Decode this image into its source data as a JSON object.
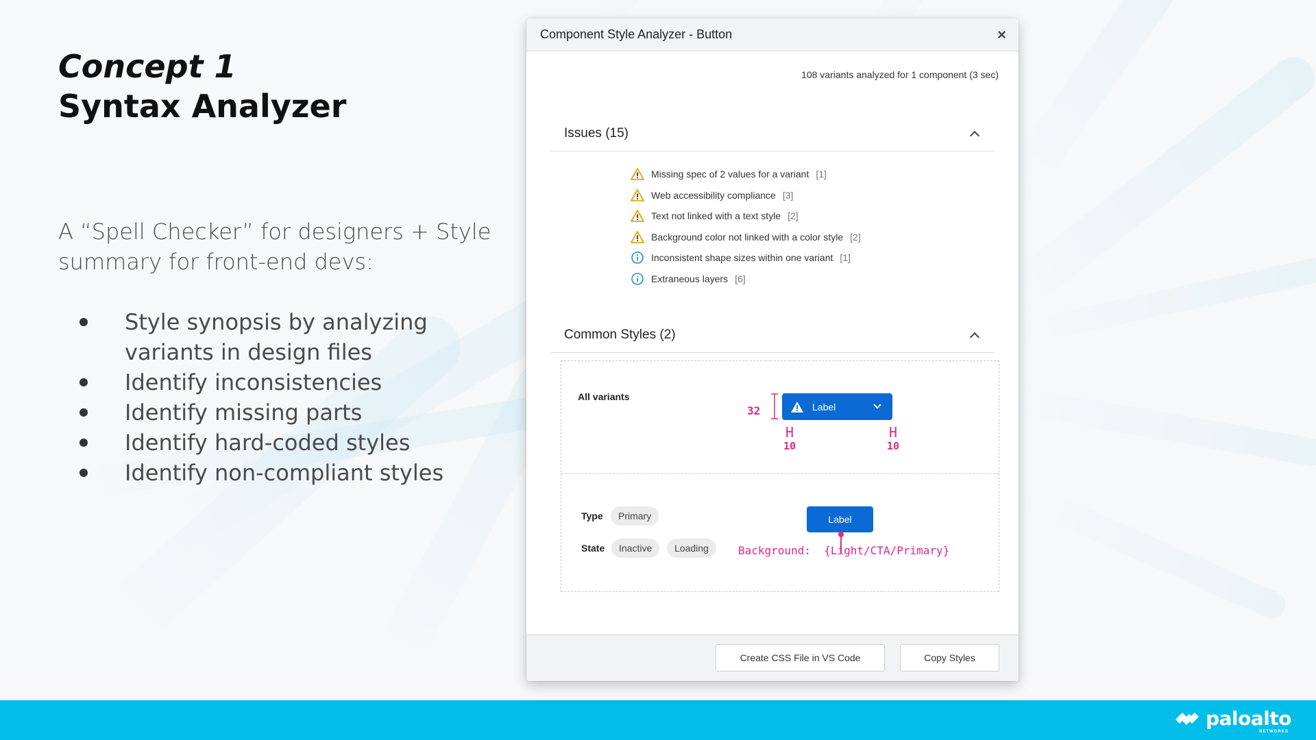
{
  "slide": {
    "title_line1": "Concept 1",
    "title_line2": "Syntax Analyzer",
    "summary": "A “Spell Checker” for designers + Style summary for front-end devs:",
    "bullets": [
      "Style synopsis by analyzing variants in design files",
      "Identify inconsistencies",
      "Identify missing parts",
      "Identify hard-coded styles",
      "Identify non-compliant styles"
    ]
  },
  "dialog": {
    "title": "Component Style Analyzer - Button",
    "close_glyph": "×",
    "meta": "108 variants analyzed for 1 component (3 sec)",
    "issues": {
      "title": "Issues (15)",
      "items": [
        {
          "icon": "warning-icon",
          "text": "Missing spec of 2 values for a variant",
          "count": "[1]"
        },
        {
          "icon": "warning-icon",
          "text": "Web accessibility compliance",
          "count": "[3]"
        },
        {
          "icon": "warning-icon",
          "text": "Text not linked with a text style",
          "count": "[2]"
        },
        {
          "icon": "warning-icon",
          "text": "Background color not linked with a color style",
          "count": "[2]"
        },
        {
          "icon": "info-icon",
          "text": "Inconsistent shape sizes within one variant",
          "count": "[1]"
        },
        {
          "icon": "info-icon",
          "text": "Extraneous layers",
          "count": "[6]"
        }
      ]
    },
    "common_styles": {
      "title": "Common Styles (2)",
      "all_variants_label": "All variants",
      "height_value": "32",
      "sample_button_label": "Label",
      "padding_left_value": "10",
      "padding_right_value": "10",
      "type_label": "Type",
      "type_chips": [
        "Primary"
      ],
      "state_label": "State",
      "state_chips": [
        "Inactive",
        "Loading"
      ],
      "sample_button2_label": "Label",
      "background_token": "Background:  {Light/CTA/Primary}"
    },
    "footer": {
      "create_css_label": "Create CSS File in VS Code",
      "copy_styles_label": "Copy Styles"
    }
  },
  "brand": {
    "logo_text": "paloalto",
    "logo_sub": "NETWORKS",
    "bar_color": "#00bde9",
    "accent_blue": "#0c6ad4",
    "annotation_pink": "#e0287f",
    "warning_color": "#e0a800",
    "info_color": "#1a8fd6"
  }
}
